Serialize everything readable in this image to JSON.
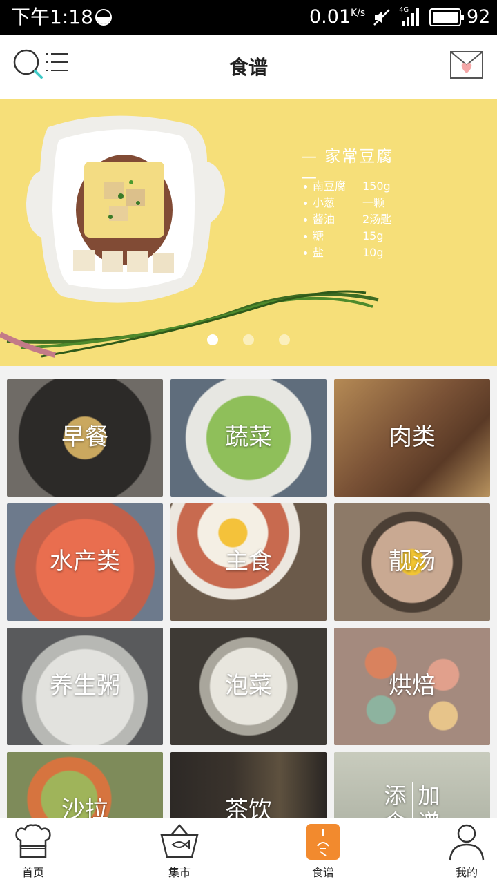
{
  "status_bar": {
    "time": "下午1:18",
    "speed": "0.01",
    "speed_unit": "K/s",
    "network": "4G",
    "battery": "92"
  },
  "header": {
    "title": "食谱",
    "icons": [
      "search-icon",
      "menu-icon",
      "mail-icon"
    ]
  },
  "banner": {
    "title": "— 家常豆腐 —",
    "ingredients": [
      {
        "name": "南豆腐",
        "amount": "150g"
      },
      {
        "name": "小葱",
        "amount": "一颗"
      },
      {
        "name": "酱油",
        "amount": "2汤匙"
      },
      {
        "name": "糖",
        "amount": "15g"
      },
      {
        "name": "盐",
        "amount": "10g"
      }
    ],
    "page_count": 3,
    "active_page": 1
  },
  "categories": [
    {
      "label": "早餐",
      "color": "#3b3835"
    },
    {
      "label": "蔬菜",
      "color": "#6f8f52"
    },
    {
      "label": "肉类",
      "color": "#7a5a3c"
    },
    {
      "label": "水产类",
      "color": "#c2604a"
    },
    {
      "label": "主食",
      "color": "#8c6a4e"
    },
    {
      "label": "靓汤",
      "color": "#7b6652"
    },
    {
      "label": "养生粥",
      "color": "#8d8e8c"
    },
    {
      "label": "泡菜",
      "color": "#5b5650"
    },
    {
      "label": "烘焙",
      "color": "#a7847a"
    },
    {
      "label": "沙拉",
      "color": "#7a8a5b"
    },
    {
      "label": "茶饮",
      "color": "#2f2b28"
    },
    {
      "label": "添加",
      "color": "#b9bbb0"
    }
  ],
  "add_tile_glyphs": [
    "添",
    "加",
    "食",
    "谱"
  ],
  "bottom_nav": {
    "items": [
      {
        "label": "首页",
        "icon": "chef-hat-icon"
      },
      {
        "label": "集市",
        "icon": "basket-icon"
      },
      {
        "label": "食谱",
        "icon": "recipe-book-icon"
      },
      {
        "label": "我的",
        "icon": "user-icon"
      }
    ],
    "active": "食谱",
    "active_color": "#f28a2e"
  }
}
